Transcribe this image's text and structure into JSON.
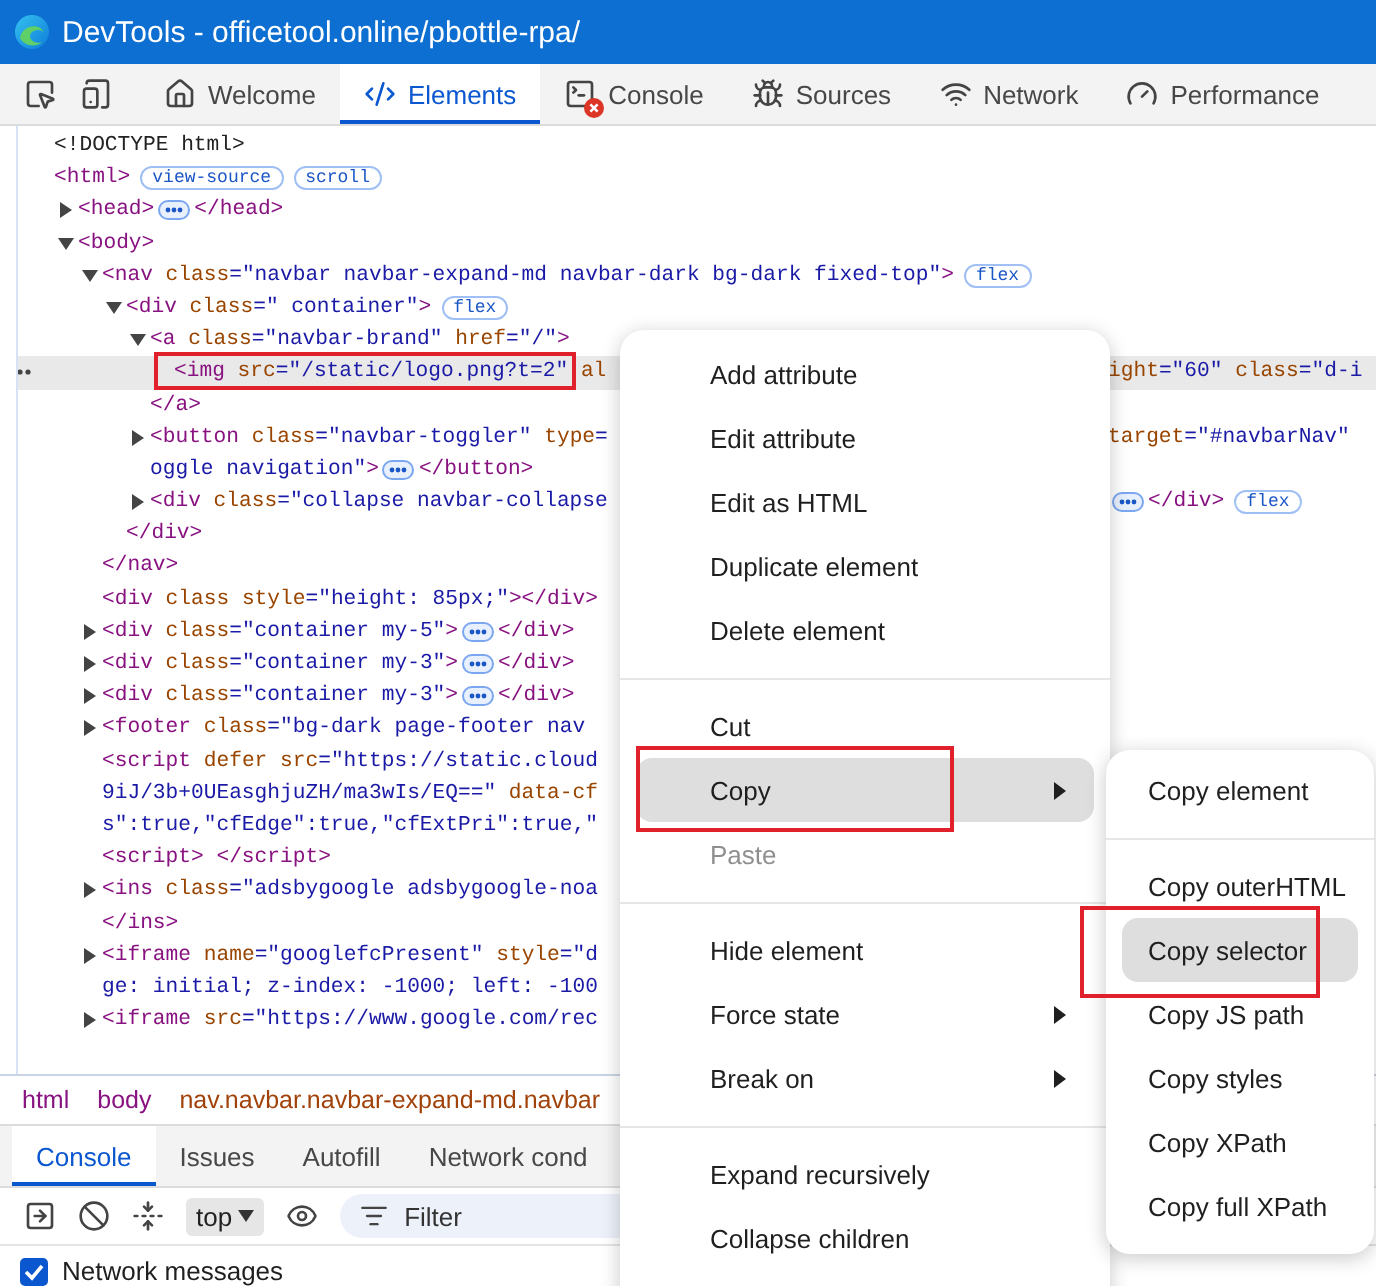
{
  "window": {
    "title": "DevTools - officetool.online/pbottle-rpa/"
  },
  "tabs": [
    {
      "label": "Welcome",
      "kind": "home",
      "selected": false,
      "error": false
    },
    {
      "label": "Elements",
      "kind": "code",
      "selected": true,
      "error": false
    },
    {
      "label": "Console",
      "kind": "terminal",
      "selected": false,
      "error": true
    },
    {
      "label": "Sources",
      "kind": "bug",
      "selected": false,
      "error": false
    },
    {
      "label": "Network",
      "kind": "wifi",
      "selected": false,
      "error": false
    },
    {
      "label": "Performance",
      "kind": "gauge",
      "selected": false,
      "error": false
    }
  ],
  "dom_tree": [
    {
      "selected": false,
      "tokens": [
        {
          "kind": "plain",
          "text": "<!DOCTYPE html>"
        }
      ]
    },
    {
      "selected": false,
      "tokens": [
        {
          "kind": "tag",
          "text": "<html>"
        },
        {
          "kind": "badge",
          "text": "view-source"
        },
        {
          "kind": "badge",
          "text": "scroll"
        }
      ],
      "children": [
        {
          "selected": false,
          "expanded": false,
          "tokens": [
            {
              "kind": "tag",
              "text": "<head>"
            },
            {
              "kind": "ellipsis"
            },
            {
              "kind": "tag",
              "text": "</head>"
            }
          ]
        },
        {
          "selected": false,
          "expanded": true,
          "tokens": [
            {
              "kind": "tag",
              "text": "<body>"
            }
          ],
          "children": [
            {
              "selected": false,
              "expanded": true,
              "tokens": [
                {
                  "kind": "tag",
                  "text": "<nav"
                },
                {
                  "kind": "attr",
                  "text": " class"
                },
                {
                  "kind": "value",
                  "text": "=\"navbar navbar-expand-md navbar-dark bg-dark fixed-top\""
                },
                {
                  "kind": "tag",
                  "text": ">"
                },
                {
                  "kind": "badge",
                  "text": "flex"
                }
              ],
              "close": [
                {
                  "kind": "tag",
                  "text": "</nav>"
                }
              ],
              "children": [
                {
                  "selected": false,
                  "expanded": true,
                  "tokens": [
                    {
                      "kind": "tag",
                      "text": "<div"
                    },
                    {
                      "kind": "attr",
                      "text": " class"
                    },
                    {
                      "kind": "value",
                      "text": "=\" container\""
                    },
                    {
                      "kind": "tag",
                      "text": ">"
                    },
                    {
                      "kind": "badge",
                      "text": "flex"
                    }
                  ],
                  "close": [
                    {
                      "kind": "tag",
                      "text": "</div>"
                    }
                  ],
                  "children": [
                    {
                      "selected": false,
                      "expanded": true,
                      "tokens": [
                        {
                          "kind": "tag",
                          "text": "<a"
                        },
                        {
                          "kind": "attr",
                          "text": " class"
                        },
                        {
                          "kind": "value",
                          "text": "=\"navbar-brand\""
                        },
                        {
                          "kind": "attr",
                          "text": " href"
                        },
                        {
                          "kind": "value",
                          "text": "=\"/\""
                        },
                        {
                          "kind": "tag",
                          "text": ">"
                        }
                      ],
                      "close": [
                        {
                          "kind": "tag",
                          "text": "</a>"
                        }
                      ],
                      "children": [
                        {
                          "selected": true,
                          "marked": true,
                          "tokens": [
                            {
                              "kind": "tag",
                              "text": "<img"
                            },
                            {
                              "kind": "attr",
                              "text": " src"
                            },
                            {
                              "kind": "value",
                              "text": "=\"/static/logo.png?t=2\""
                            },
                            {
                              "kind": "attr",
                              "text": " al"
                            }
                          ],
                          "right": [
                            {
                              "kind": "attr",
                              "text": "ight"
                            },
                            {
                              "kind": "value",
                              "text": "=\"60\""
                            },
                            {
                              "kind": "attr",
                              "text": " class"
                            },
                            {
                              "kind": "value",
                              "text": "=\"d-i"
                            }
                          ]
                        }
                      ]
                    },
                    {
                      "selected": false,
                      "expanded": false,
                      "tokens": [
                        {
                          "kind": "tag",
                          "text": "<button"
                        },
                        {
                          "kind": "attr",
                          "text": " class"
                        },
                        {
                          "kind": "value",
                          "text": "=\"navbar-toggler\""
                        },
                        {
                          "kind": "attr",
                          "text": " type"
                        },
                        {
                          "kind": "value",
                          "text": "="
                        }
                      ],
                      "right": [
                        {
                          "kind": "attr",
                          "text": "target"
                        },
                        {
                          "kind": "value",
                          "text": "=\"#navbarNav\""
                        }
                      ],
                      "continuation": [
                        [
                          {
                            "kind": "value",
                            "text": "oggle navigation\""
                          },
                          {
                            "kind": "tag",
                            "text": ">"
                          },
                          {
                            "kind": "ellipsis"
                          },
                          {
                            "kind": "tag",
                            "text": "</button>"
                          }
                        ]
                      ]
                    },
                    {
                      "selected": false,
                      "expanded": false,
                      "tokens": [
                        {
                          "kind": "tag",
                          "text": "<div"
                        },
                        {
                          "kind": "attr",
                          "text": " class"
                        },
                        {
                          "kind": "value",
                          "text": "=\"collapse navbar-collapse"
                        }
                      ],
                      "right": [
                        {
                          "kind": "ellipsis"
                        },
                        {
                          "kind": "tag",
                          "text": "</div>"
                        },
                        {
                          "kind": "badge",
                          "text": "flex"
                        }
                      ]
                    }
                  ]
                }
              ]
            },
            {
              "selected": false,
              "tokens": [
                {
                  "kind": "tag",
                  "text": "<div"
                },
                {
                  "kind": "attr",
                  "text": " class style"
                },
                {
                  "kind": "value",
                  "text": "=\"height: 85px;\""
                },
                {
                  "kind": "tag",
                  "text": "></div>"
                }
              ]
            },
            {
              "selected": false,
              "expanded": false,
              "tokens": [
                {
                  "kind": "tag",
                  "text": "<div"
                },
                {
                  "kind": "attr",
                  "text": " class"
                },
                {
                  "kind": "value",
                  "text": "=\"container my-5\""
                },
                {
                  "kind": "tag",
                  "text": ">"
                },
                {
                  "kind": "ellipsis"
                },
                {
                  "kind": "tag",
                  "text": "</div>"
                }
              ]
            },
            {
              "selected": false,
              "expanded": false,
              "tokens": [
                {
                  "kind": "tag",
                  "text": "<div"
                },
                {
                  "kind": "attr",
                  "text": " class"
                },
                {
                  "kind": "value",
                  "text": "=\"container my-3\""
                },
                {
                  "kind": "tag",
                  "text": ">"
                },
                {
                  "kind": "ellipsis"
                },
                {
                  "kind": "tag",
                  "text": "</div>"
                }
              ]
            },
            {
              "selected": false,
              "expanded": false,
              "tokens": [
                {
                  "kind": "tag",
                  "text": "<div"
                },
                {
                  "kind": "attr",
                  "text": " class"
                },
                {
                  "kind": "value",
                  "text": "=\"container my-3\""
                },
                {
                  "kind": "tag",
                  "text": ">"
                },
                {
                  "kind": "ellipsis"
                },
                {
                  "kind": "tag",
                  "text": "</div>"
                }
              ]
            },
            {
              "selected": false,
              "expanded": false,
              "tokens": [
                {
                  "kind": "tag",
                  "text": "<footer"
                },
                {
                  "kind": "attr",
                  "text": " class"
                },
                {
                  "kind": "value",
                  "text": "=\"bg-dark page-footer nav"
                }
              ]
            },
            {
              "selected": false,
              "tokens": [
                {
                  "kind": "tag",
                  "text": "<script"
                },
                {
                  "kind": "attr",
                  "text": " defer src"
                },
                {
                  "kind": "value",
                  "text": "=\"https://static.cloud"
                }
              ],
              "continuation": [
                [
                  {
                    "kind": "value",
                    "text": "9iJ/3b+0UEasghjuZH/ma3wIs/EQ==\""
                  },
                  {
                    "kind": "attr",
                    "text": " data-cf"
                  }
                ],
                [
                  {
                    "kind": "value",
                    "text": "s\":true,\"cfEdge\":true,\"cfExtPri\":true,\""
                  }
                ]
              ]
            },
            {
              "selected": false,
              "tokens": [
                {
                  "kind": "tag",
                  "text": "<script> </script>"
                }
              ]
            },
            {
              "selected": false,
              "expanded": false,
              "tokens": [
                {
                  "kind": "tag",
                  "text": "<ins"
                },
                {
                  "kind": "attr",
                  "text": " class"
                },
                {
                  "kind": "value",
                  "text": "=\"adsbygoogle adsbygoogle-noa"
                }
              ],
              "close": [
                {
                  "kind": "tag",
                  "text": "</ins>"
                }
              ]
            },
            {
              "selected": false,
              "expanded": false,
              "tokens": [
                {
                  "kind": "tag",
                  "text": "<iframe"
                },
                {
                  "kind": "attr",
                  "text": " name"
                },
                {
                  "kind": "value",
                  "text": "=\"googlefcPresent\""
                },
                {
                  "kind": "attr",
                  "text": " style"
                },
                {
                  "kind": "value",
                  "text": "=\"d"
                }
              ],
              "continuation": [
                [
                  {
                    "kind": "value",
                    "text": "ge: initial; z-index: -1000; left: -100"
                  }
                ]
              ]
            },
            {
              "selected": false,
              "expanded": false,
              "tokens": [
                {
                  "kind": "tag",
                  "text": "<iframe"
                },
                {
                  "kind": "attr",
                  "text": " src"
                },
                {
                  "kind": "value",
                  "text": "=\"https://www.google.com/rec"
                }
              ]
            }
          ]
        }
      ]
    }
  ],
  "breadcrumbs": [
    {
      "label": "html",
      "kind": "tag"
    },
    {
      "label": "body",
      "kind": "tag"
    },
    {
      "label": "nav.navbar.navbar-expand-md.navbar",
      "kind": "selector"
    }
  ],
  "drawer_tabs": [
    {
      "label": "Console",
      "selected": true
    },
    {
      "label": "Issues",
      "selected": false
    },
    {
      "label": "Autofill",
      "selected": false
    },
    {
      "label": "Network cond",
      "selected": false
    }
  ],
  "console_toolbar": {
    "context": "top",
    "filter": {
      "placeholder": "Filter"
    }
  },
  "console_settings": [
    {
      "label": "Network messages",
      "checked": true
    }
  ],
  "context_menu": [
    {
      "kind": "item",
      "label": "Add attribute",
      "selected": false,
      "disabled": false,
      "submenu": false
    },
    {
      "kind": "item",
      "label": "Edit attribute",
      "selected": false,
      "disabled": false,
      "submenu": false
    },
    {
      "kind": "item",
      "label": "Edit as HTML",
      "selected": false,
      "disabled": false,
      "submenu": false
    },
    {
      "kind": "item",
      "label": "Duplicate element",
      "selected": false,
      "disabled": false,
      "submenu": false
    },
    {
      "kind": "item",
      "label": "Delete element",
      "selected": false,
      "disabled": false,
      "submenu": false
    },
    {
      "kind": "separator"
    },
    {
      "kind": "item",
      "label": "Cut",
      "selected": false,
      "disabled": false,
      "submenu": false
    },
    {
      "kind": "item",
      "label": "Copy",
      "selected": true,
      "disabled": false,
      "submenu": true,
      "marked": true
    },
    {
      "kind": "item",
      "label": "Paste",
      "selected": false,
      "disabled": true,
      "submenu": false
    },
    {
      "kind": "separator"
    },
    {
      "kind": "item",
      "label": "Hide element",
      "selected": false,
      "disabled": false,
      "submenu": false
    },
    {
      "kind": "item",
      "label": "Force state",
      "selected": false,
      "disabled": false,
      "submenu": true
    },
    {
      "kind": "item",
      "label": "Break on",
      "selected": false,
      "disabled": false,
      "submenu": true
    },
    {
      "kind": "separator"
    },
    {
      "kind": "item",
      "label": "Expand recursively",
      "selected": false,
      "disabled": false,
      "submenu": false
    },
    {
      "kind": "item",
      "label": "Collapse children",
      "selected": false,
      "disabled": false,
      "submenu": false
    }
  ],
  "copy_submenu": [
    {
      "kind": "item",
      "label": "Copy element",
      "selected": false
    },
    {
      "kind": "separator"
    },
    {
      "kind": "item",
      "label": "Copy outerHTML",
      "selected": false
    },
    {
      "kind": "item",
      "label": "Copy selector",
      "selected": true,
      "marked": true
    },
    {
      "kind": "item",
      "label": "Copy JS path",
      "selected": false
    },
    {
      "kind": "item",
      "label": "Copy styles",
      "selected": false
    },
    {
      "kind": "item",
      "label": "Copy XPath",
      "selected": false
    },
    {
      "kind": "item",
      "label": "Copy full XPath",
      "selected": false
    }
  ]
}
